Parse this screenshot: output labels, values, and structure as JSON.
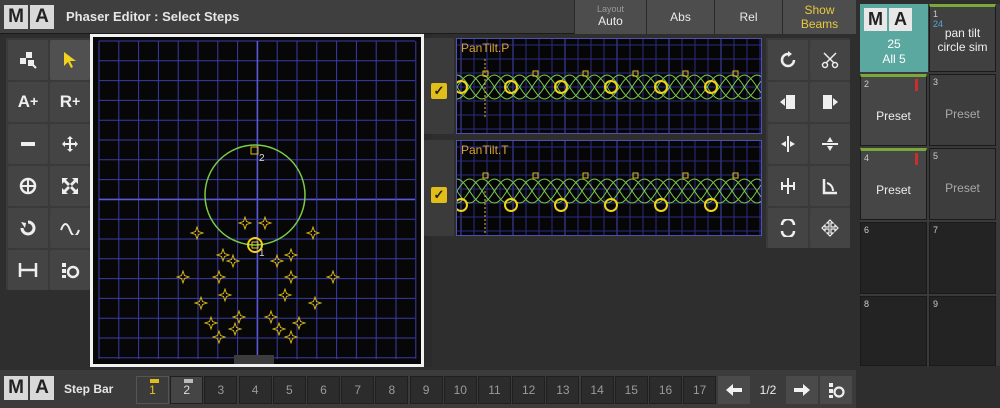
{
  "titlebar": {
    "logo": [
      "M",
      "A"
    ],
    "title": "Phaser Editor : Select Steps",
    "layout_label": "Layout",
    "layout_value": "Auto",
    "abs_label": "Abs",
    "rel_label": "Rel",
    "show_beams_label_1": "Show",
    "show_beams_label_2": "Beams"
  },
  "left_tools": {
    "icons": [
      "select-multiple-icon",
      "pointer-icon",
      "add-a-icon",
      "add-r-icon",
      "minus-icon",
      "move-icon",
      "center-icon",
      "expand-icon",
      "rotate-icon",
      "wave-icon",
      "width-icon",
      "step-align-icon"
    ],
    "add_a": "A",
    "add_r": "R",
    "plus": "+"
  },
  "channels": [
    {
      "label": "PanTilt.P",
      "checked": true
    },
    {
      "label": "PanTilt.T",
      "checked": true
    }
  ],
  "canvas": {
    "step_label_1": "1",
    "step_label_2": "2"
  },
  "right_tools": {
    "icons": [
      "refresh-icon",
      "cut-icon",
      "paste-left-icon",
      "paste-right-icon",
      "split-vertical-icon",
      "split-horizontal-icon",
      "align-center-icon",
      "measure-icon",
      "loop-icon",
      "move-all-icon"
    ]
  },
  "preset_pool": {
    "logo": [
      "M",
      "A"
    ],
    "header_count": "25",
    "header_label": "All 5",
    "cells": [
      {
        "num": "1",
        "sub": "24",
        "label": "pan tilt circle sim"
      },
      {
        "num": "2",
        "label": "Preset"
      },
      {
        "num": "3",
        "label": "Preset"
      },
      {
        "num": "4",
        "label": "Preset"
      },
      {
        "num": "5",
        "label": "Preset"
      },
      {
        "num": "6",
        "label": ""
      },
      {
        "num": "7",
        "label": ""
      },
      {
        "num": "8",
        "label": ""
      },
      {
        "num": "9",
        "label": ""
      }
    ]
  },
  "stepbar": {
    "logo": [
      "M",
      "A"
    ],
    "label": "Step Bar",
    "steps": [
      "1",
      "2",
      "3",
      "4",
      "5",
      "6",
      "7",
      "8",
      "9",
      "10",
      "11",
      "12",
      "13",
      "14",
      "15",
      "16",
      "17"
    ],
    "active_step": "1",
    "page": "1/2",
    "prev_icon": "arrow-left-icon",
    "next_icon": "arrow-right-icon",
    "settings_icon": "step-settings-icon"
  },
  "colors": {
    "accent_yellow": "#e2be1a",
    "grid_blue": "#3c3ca8",
    "curve_green": "#7acb4a",
    "pool_header": "#5aa8a0",
    "step_label": "#d8a030"
  }
}
